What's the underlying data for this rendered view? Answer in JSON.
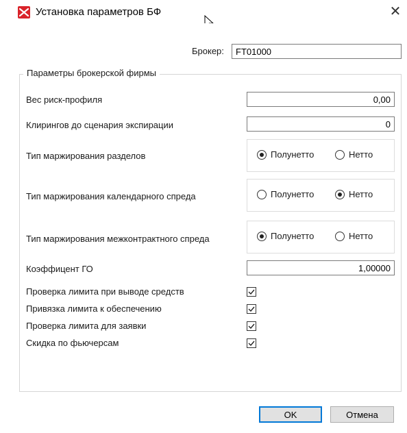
{
  "window": {
    "title": "Установка параметров БФ",
    "close_symbol": "✕",
    "icon": "moex-logo-icon",
    "icon_color": "#d9232a"
  },
  "broker": {
    "label": "Брокер:",
    "value": "FT01000"
  },
  "group": {
    "title": "Параметры брокерской фирмы"
  },
  "fields": {
    "risk_profile": {
      "label": "Вес риск-профиля",
      "value": "0,00"
    },
    "clearings": {
      "label": "Клирингов до сценария экспирации",
      "value": "0"
    },
    "go_coef": {
      "label": "Коэффицент ГО",
      "value": "1,00000"
    }
  },
  "margining": [
    {
      "label": "Тип маржирования разделов",
      "options": [
        "Полунетто",
        "Нетто"
      ],
      "selected": "Полунетто"
    },
    {
      "label": "Тип маржирования календарного спреда",
      "options": [
        "Полунетто",
        "Нетто"
      ],
      "selected": "Нетто"
    },
    {
      "label": "Тип маржирования межконтрактного спреда",
      "options": [
        "Полунетто",
        "Нетто"
      ],
      "selected": "Полунетто"
    }
  ],
  "checks": [
    {
      "label": "Проверка лимита при выводе средств",
      "checked": true
    },
    {
      "label": "Привязка лимита к обеспечению",
      "checked": true
    },
    {
      "label": "Проверка лимита для заявки",
      "checked": true
    },
    {
      "label": "Скидка по фьючерсам",
      "checked": true
    }
  ],
  "buttons": {
    "ok": "OK",
    "cancel": "Отмена",
    "accent": "#0078d7"
  }
}
